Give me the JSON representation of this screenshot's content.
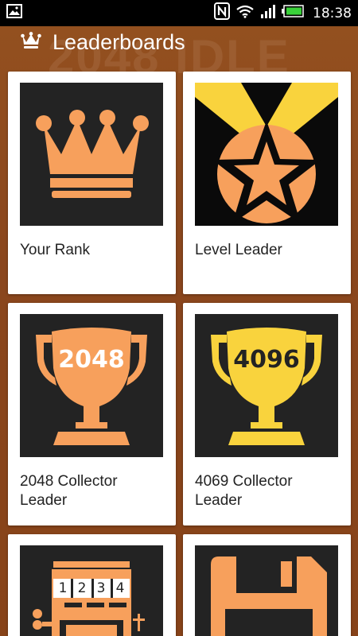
{
  "status_bar": {
    "time": "18:38",
    "icons": [
      "picture-icon",
      "nfc-icon",
      "wifi-icon",
      "signal-icon",
      "battery-icon"
    ]
  },
  "background_watermark": "2048 IDLE",
  "action_bar": {
    "title": "Leaderboards",
    "icon": "crown-icon"
  },
  "leaderboards": [
    {
      "label": "Your Rank",
      "icon": "crown-icon"
    },
    {
      "label": "Level Leader",
      "icon": "star-medal-icon"
    },
    {
      "label": "2048 Collector Leader",
      "icon": "trophy-icon",
      "trophy_text": "2048"
    },
    {
      "label": "4069 Collector Leader",
      "icon": "trophy-icon",
      "trophy_text": "4096"
    },
    {
      "label": "",
      "icon": "slot-machine-icon",
      "reel_numbers": [
        "1",
        "2",
        "3",
        "4"
      ]
    },
    {
      "label": "",
      "icon": "floppy-disk-icon"
    }
  ],
  "colors": {
    "accent_orange": "#f7a05c",
    "accent_yellow": "#f9d33d",
    "tile_dark": "#232323",
    "background_brown": "#8a4620"
  }
}
